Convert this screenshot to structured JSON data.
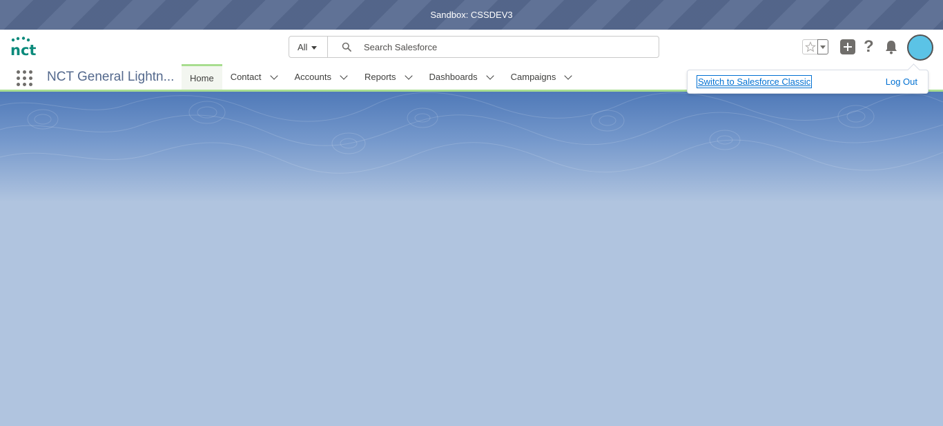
{
  "sandbox": {
    "label": "Sandbox: CSSDEV3"
  },
  "search": {
    "scope": "All",
    "placeholder": "Search Salesforce"
  },
  "nav": {
    "app_name": "NCT General Lightn...",
    "tabs": [
      {
        "label": "Home",
        "active": true
      },
      {
        "label": "Contact"
      },
      {
        "label": "Accounts"
      },
      {
        "label": "Reports"
      },
      {
        "label": "Dashboards"
      },
      {
        "label": "Campaigns"
      }
    ]
  },
  "user_menu": {
    "switch_label": "Switch to Salesforce Classic",
    "logout_label": "Log Out"
  },
  "colors": {
    "brand_teal": "#0b8a7b",
    "nav_accent": "#a8dd8f",
    "link": "#0070d2",
    "avatar": "#5bc3e6"
  },
  "icons": [
    "nct-logo",
    "search-icon",
    "star-icon",
    "chevron-down-icon",
    "add-icon",
    "help-icon",
    "bell-icon",
    "app-launcher-icon"
  ]
}
